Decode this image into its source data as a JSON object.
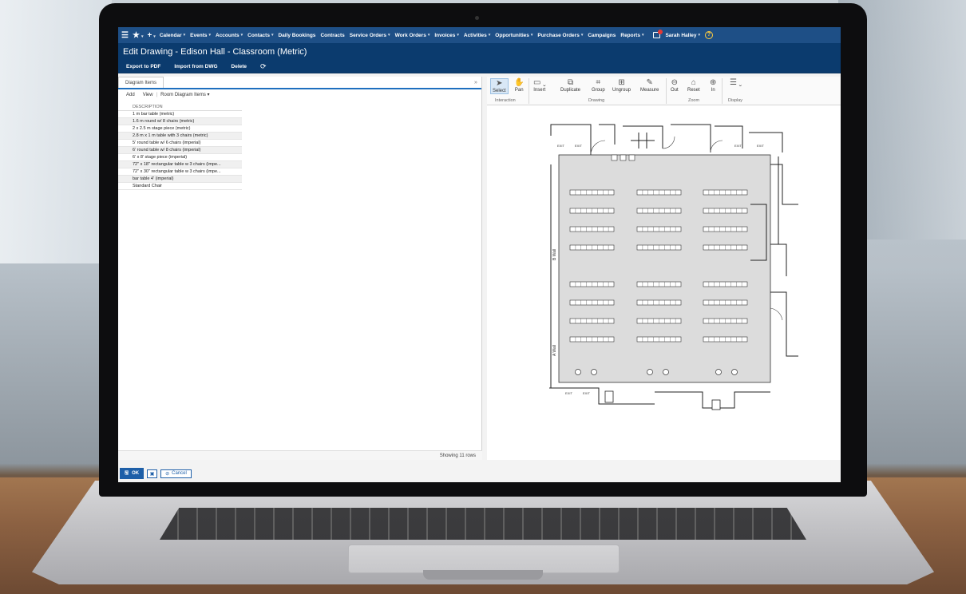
{
  "nav": {
    "items": [
      "Calendar",
      "Events",
      "Accounts",
      "Contacts",
      "Daily Bookings",
      "Contracts",
      "Service Orders",
      "Work Orders",
      "Invoices",
      "Activities",
      "Opportunities",
      "Purchase Orders",
      "Campaigns",
      "Reports"
    ],
    "user": "Sarah Halley",
    "help": "?"
  },
  "page": {
    "title": "Edit Drawing - Edison Hall - Classroom (Metric)"
  },
  "toolbar": {
    "export_label": "Export to PDF",
    "import_label": "Import from DWG",
    "delete_label": "Delete"
  },
  "left": {
    "tab_label": "Diagram Items",
    "add_label": "Add",
    "view_label": "View",
    "view_value": "Room Diagram Items",
    "column_header": "DESCRIPTION",
    "rows": [
      "1 m bar table (metric)",
      "1.6 m round w/ 8 chairs (metric)",
      "2 x 2.5 m stage piece (metric)",
      "2.8 m x 1 m table with 3 chairs (metric)",
      "5' round table w/ 6 chairs (imperial)",
      "6' round table w/ 8 chairs (imperial)",
      "6' x 8' stage piece (imperial)",
      "72\" x 18\" rectangular table w 3 chairs (impe...",
      "72\" x 30\" rectangular table w 3 chairs (impe...",
      "bar table 4' (imperial)",
      "Standard Chair"
    ],
    "footer": "Showing 11 rows"
  },
  "ribbon": {
    "select": "Select",
    "pan": "Pan",
    "insert": "Insert",
    "duplicate": "Duplicate",
    "group": "Group",
    "ungroup": "Ungroup",
    "measure": "Measure",
    "out": "Out",
    "reset": "Reset",
    "in": "In",
    "group_interaction": "Interaction",
    "group_drawing": "Drawing",
    "group_zoom": "Zoom",
    "group_display": "Display"
  },
  "floorplan": {
    "wall_b_label": "B Wall",
    "wall_a_label": "A Wall",
    "exit_label": "EXIT"
  },
  "bottom": {
    "ok_label": "OK",
    "cancel_label": "Cancel"
  }
}
